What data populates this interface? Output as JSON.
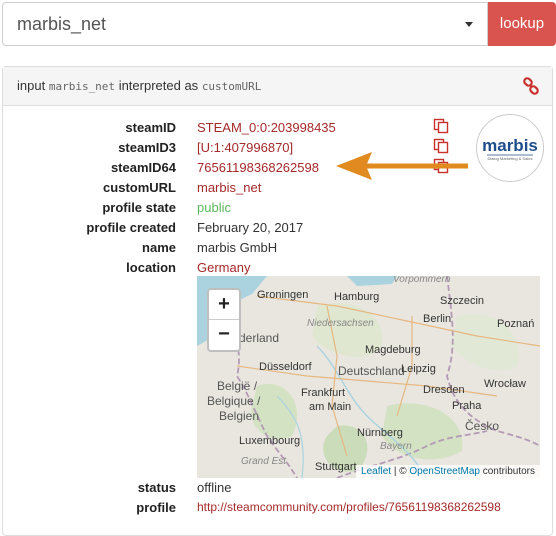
{
  "search": {
    "value": "marbis_net"
  },
  "lookup_label": "lookup",
  "header": {
    "prefix": "input",
    "input_value": "marbis_net",
    "middle": "interpreted as",
    "type": "customURL"
  },
  "profile": {
    "rows": [
      {
        "label": "steamID",
        "value": "STEAM_0:0:203998435"
      },
      {
        "label": "steamID3",
        "value": "[U:1:407996870]"
      },
      {
        "label": "steamID64",
        "value": "76561198368262598"
      },
      {
        "label": "customURL",
        "value": "marbis_net"
      },
      {
        "label": "profile state",
        "value": "public"
      },
      {
        "label": "profile created",
        "value": "February 20, 2017"
      },
      {
        "label": "name",
        "value": "marbis GmbH"
      },
      {
        "label": "location",
        "value": "Germany"
      }
    ],
    "status_label": "status",
    "status_value": "offline",
    "profile_label": "profile",
    "profile_url": "http://steamcommunity.com/profiles/76561198368262598"
  },
  "logo": {
    "text": "marbis",
    "tagline": "Dialog Marketing & Sales"
  },
  "map": {
    "zoom_in": "+",
    "zoom_out": "−",
    "attribution_leaflet": "Leaflet",
    "attribution_sep": "| ©",
    "attribution_osm": "OpenStreetMap",
    "attribution_tail": "contributors",
    "labels": {
      "vorpommern": "Vorpommern",
      "groningen": "Groningen",
      "hamburg": "Hamburg",
      "szczecin": "Szczecin",
      "niedersachsen": "Niedersachsen",
      "berlin": "Berlin",
      "nederland": "derland",
      "poznan": "Poznań",
      "magdeburg": "Magdeburg",
      "dusseldorf": "Düsseldorf",
      "deutschland": "Deutschland",
      "leipzig": "Leipzig",
      "wroclaw": "Wrocław",
      "belgie1": "België /",
      "belgique": "Belgique /",
      "belgien": "Belgien",
      "frankfurt1": "Frankfurt",
      "frankfurt2": "am Main",
      "dresden": "Dresden",
      "praha": "Praha",
      "luxembourg": "Luxembourg",
      "nurnberg": "Nürnberg",
      "cesko": "Česko",
      "bayern": "Bayern",
      "grandest": "Grand Est",
      "stuttgart": "Stuttgart"
    }
  }
}
